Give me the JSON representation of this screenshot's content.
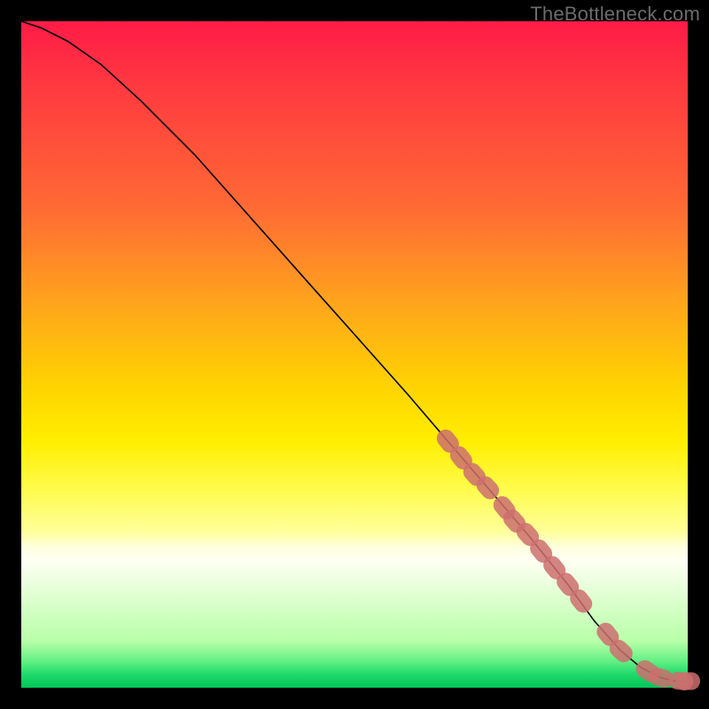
{
  "watermark": "TheBottleneck.com",
  "colors": {
    "marker": "#cc6e6e",
    "curve": "#000000"
  },
  "chart_data": {
    "type": "line",
    "title": "",
    "xlabel": "",
    "ylabel": "",
    "xlim": [
      0,
      100
    ],
    "ylim": [
      0,
      100
    ],
    "grid": false,
    "series": [
      {
        "name": "bottleneck-curve",
        "x": [
          0,
          3,
          7,
          12,
          18,
          26,
          34,
          42,
          50,
          58,
          64,
          70,
          76,
          82,
          86,
          90,
          93,
          96,
          98,
          100
        ],
        "y": [
          100,
          99,
          97,
          93.5,
          88,
          80,
          71,
          62,
          53,
          44,
          37,
          30,
          23,
          15.5,
          10,
          5.5,
          3,
          1.5,
          1,
          1
        ]
      }
    ],
    "markers": {
      "name": "highlighted-segment",
      "x": [
        64,
        66,
        68,
        70,
        72.5,
        74,
        76,
        78,
        80,
        82,
        84,
        88,
        90,
        94,
        96,
        99,
        100
      ],
      "y": [
        37,
        34.5,
        32,
        30,
        27,
        25,
        23,
        20.5,
        18,
        15.5,
        13,
        8,
        5.5,
        2.5,
        1.5,
        1,
        1
      ]
    }
  }
}
